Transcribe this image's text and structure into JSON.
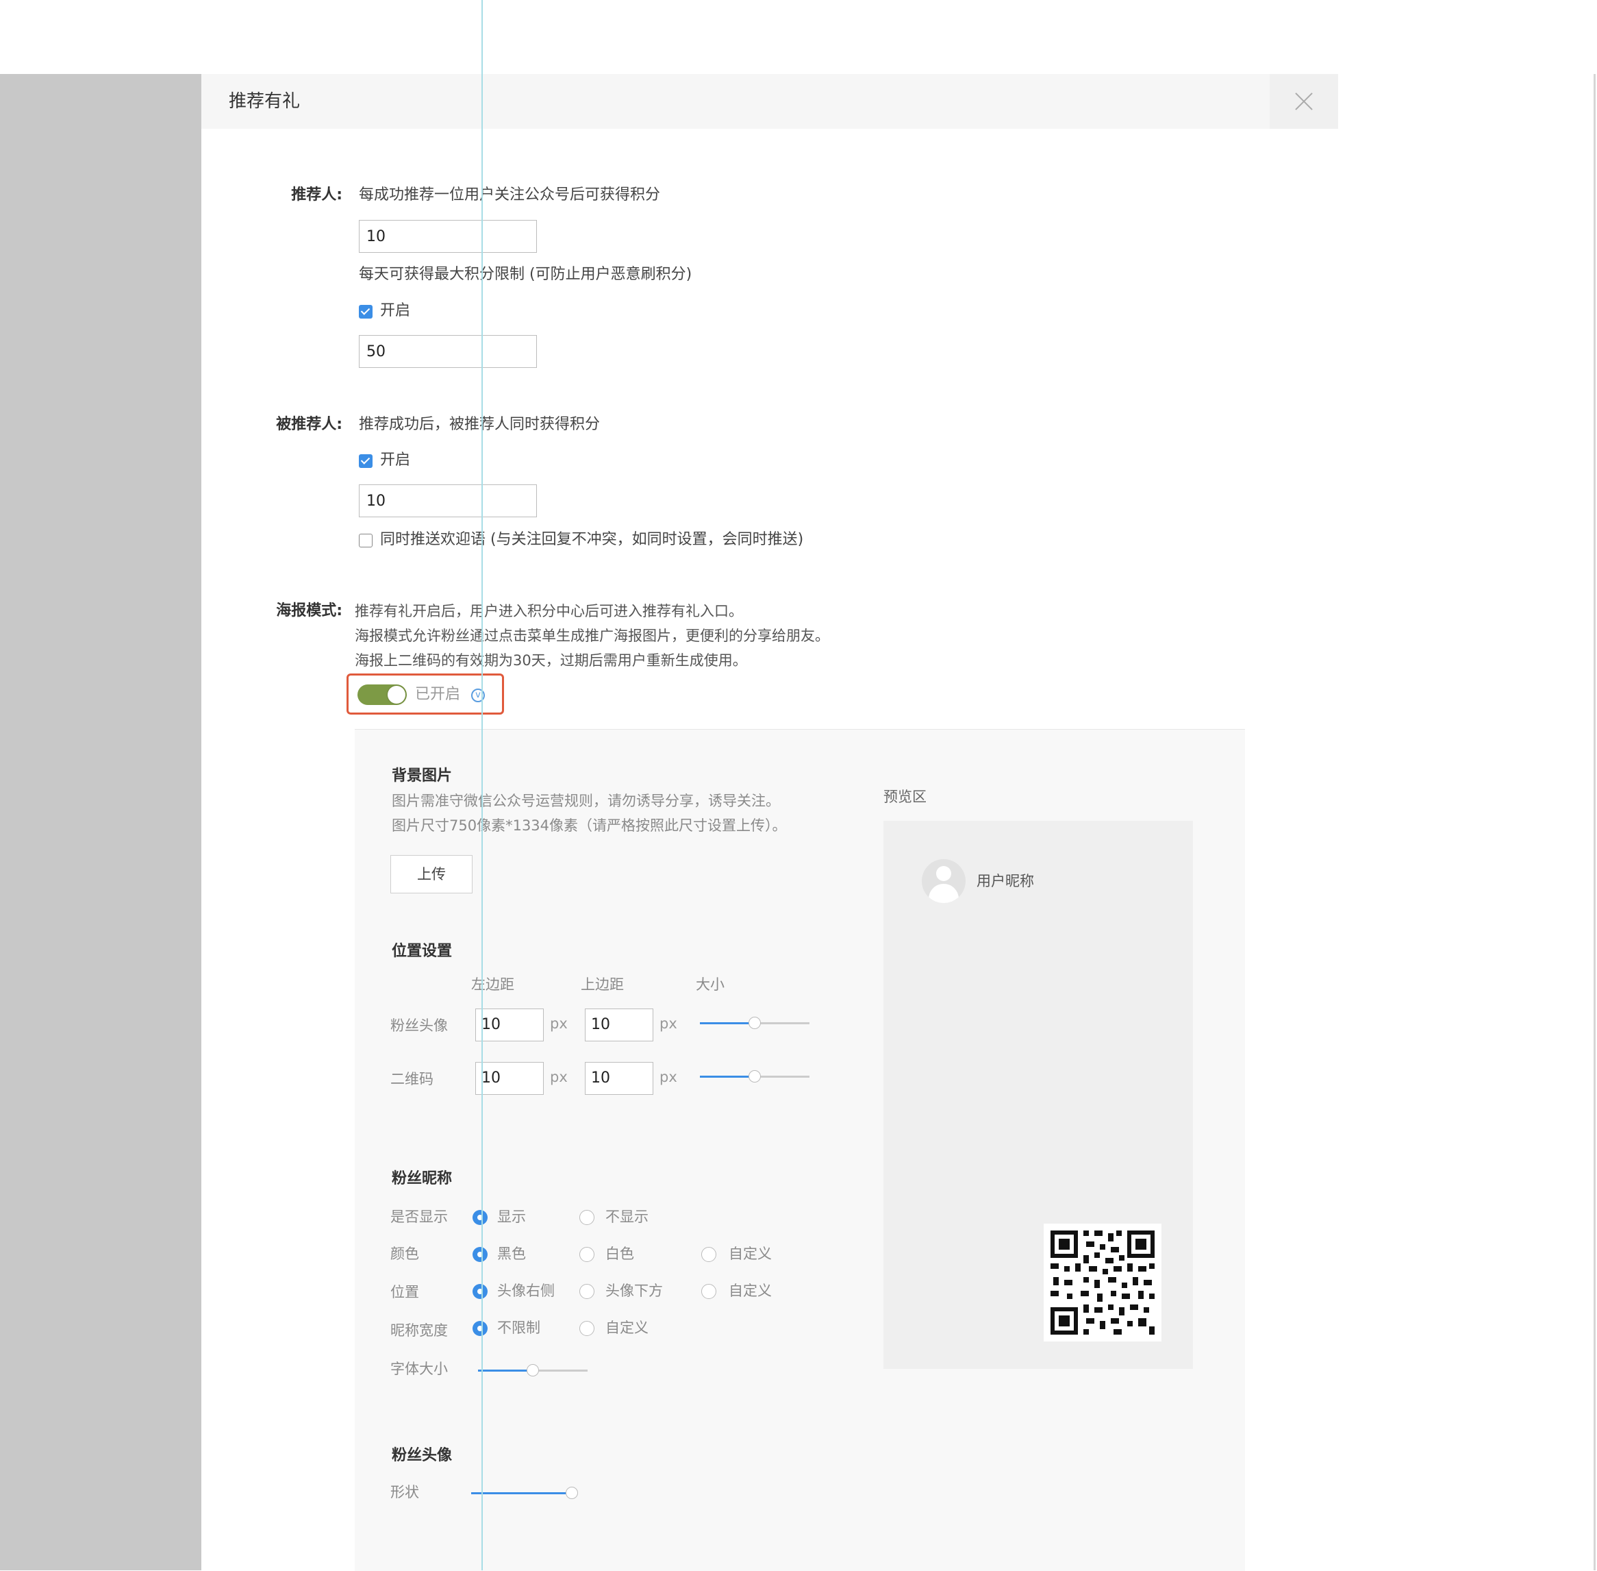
{
  "modal": {
    "title": "推荐有礼"
  },
  "referrer": {
    "label": "推荐人:",
    "desc": "每成功推荐一位用户关注公众号后可获得积分",
    "points_value": "10",
    "limit_desc": "每天可获得最大积分限制 (可防止用户恶意刷积分)",
    "enable_label": "开启",
    "enable_checked": true,
    "limit_value": "50"
  },
  "referee": {
    "label": "被推荐人:",
    "desc": "推荐成功后，被推荐人同时获得积分",
    "enable_label": "开启",
    "enable_checked": true,
    "points_value": "10",
    "welcome_label": "同时推送欢迎语 (与关注回复不冲突，如同时设置，会同时推送)",
    "welcome_checked": false
  },
  "poster": {
    "label": "海报模式:",
    "desc_1": "推荐有礼开启后，用户进入积分中心后可进入推荐有礼入口。",
    "desc_2": "海报模式允许粉丝通过点击菜单生成推广海报图片，更便利的分享给朋友。",
    "desc_3": "海报上二维码的有效期为30天，过期后需用户重新生成使用。",
    "toggle_label": "已开启",
    "toggle_on": true,
    "toggle_color": "#7d9a45",
    "info_icon": "v"
  },
  "background": {
    "title": "背景图片",
    "hint_1": "图片需准守微信公众号运营规则，请勿诱导分享，诱导关注。",
    "hint_2": "图片尺寸750像素*1334像素（请严格按照此尺寸设置上传）。",
    "upload_label": "上传"
  },
  "position": {
    "title": "位置设置",
    "col_left": "左边距",
    "col_top": "上边距",
    "col_size": "大小",
    "unit": "px",
    "rows": [
      {
        "label": "粉丝头像",
        "left": "10",
        "top": "10",
        "size_fraction": 0.5
      },
      {
        "label": "二维码",
        "left": "10",
        "top": "10",
        "size_fraction": 0.5
      }
    ]
  },
  "nickname": {
    "title": "粉丝昵称",
    "show_label": "是否显示",
    "show_options": [
      "显示",
      "不显示"
    ],
    "show_selected": 0,
    "color_label": "颜色",
    "color_options": [
      "黑色",
      "白色",
      "自定义"
    ],
    "color_selected": 0,
    "pos_label": "位置",
    "pos_options": [
      "头像右侧",
      "头像下方",
      "自定义"
    ],
    "pos_selected": 0,
    "width_label": "昵称宽度",
    "width_options": [
      "不限制",
      "自定义"
    ],
    "width_selected": 0,
    "font_label": "字体大小",
    "font_fraction": 0.5
  },
  "avatar_settings": {
    "title": "粉丝头像",
    "shape_label": "形状",
    "shape_fraction": 0.97
  },
  "preview": {
    "title": "预览区",
    "nickname": "用户昵称",
    "avatar_icon": "user-avatar-icon",
    "qr_icon": "qr-code-icon"
  },
  "colors": {
    "accent": "#3b8ee6",
    "highlight_border": "#e05a3c",
    "toggle_on": "#7d9a45"
  }
}
